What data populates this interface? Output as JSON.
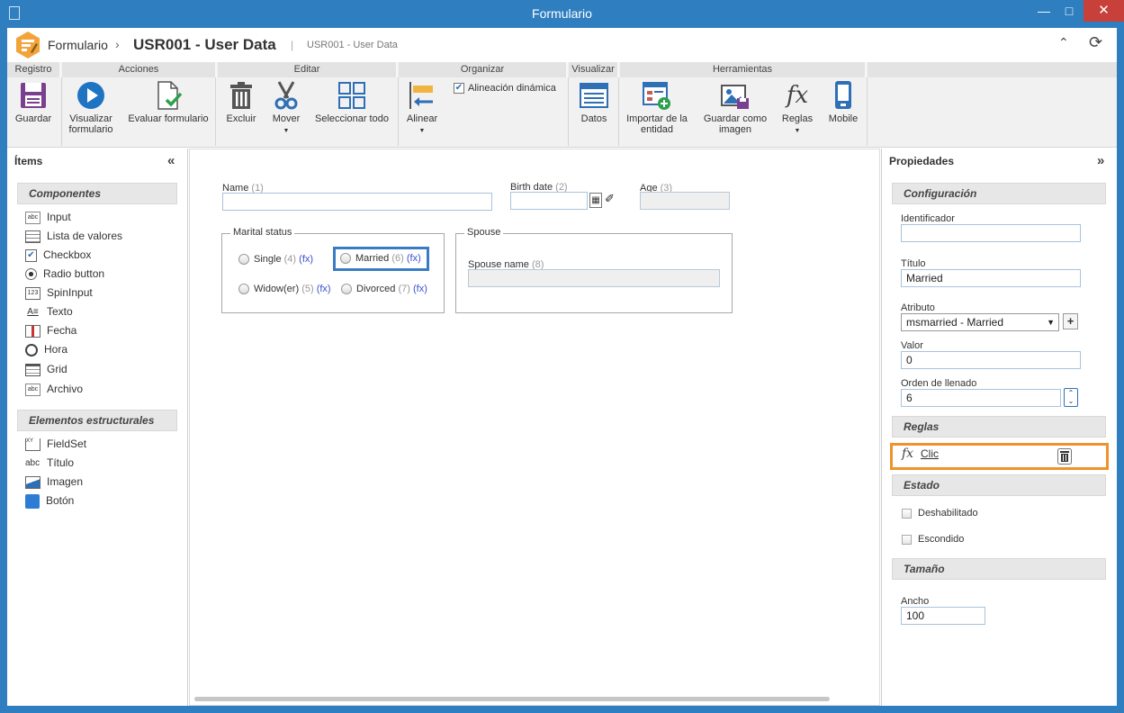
{
  "window": {
    "title": "Formulario",
    "minimize": "—",
    "maximize": "□",
    "close": "✕"
  },
  "header": {
    "app_name": "Formulario",
    "separator": "›",
    "doc_title": "USR001 - User Data",
    "pipe": "|",
    "doc_subtitle": "USR001 - User Data"
  },
  "ribbon": {
    "groups": [
      "Registro",
      "Acciones",
      "Editar",
      "Organizar",
      "Visualizar",
      "Herramientas"
    ],
    "buttons": {
      "guardar": "Guardar",
      "visualizar_1": "Visualizar",
      "visualizar_2": "formulario",
      "evaluar": "Evaluar formulario",
      "excluir": "Excluir",
      "mover": "Mover",
      "seleccionar": "Seleccionar todo",
      "alinear": "Alinear",
      "alineacion_dinamica": "Alineación dinámica",
      "datos": "Datos",
      "importar_1": "Importar de la",
      "importar_2": "entidad",
      "guardar_imagen_1": "Guardar como",
      "guardar_imagen_2": "imagen",
      "reglas": "Reglas",
      "mobile": "Mobile"
    },
    "alineacion_checked": true
  },
  "left_panel": {
    "title": "Ítems",
    "sections": {
      "componentes": "Componentes",
      "estructurales": "Elementos estructurales"
    },
    "components": [
      "Input",
      "Lista de valores",
      "Checkbox",
      "Radio button",
      "SpinInput",
      "Texto",
      "Fecha",
      "Hora",
      "Grid",
      "Archivo"
    ],
    "structural": [
      "FieldSet",
      "Título",
      "Imagen",
      "Botón"
    ]
  },
  "form": {
    "name_label": "Name",
    "name_num": "(1)",
    "birth_label": "Birth date",
    "birth_num": "(2)",
    "age_label": "Age",
    "age_num": "(3)",
    "marital_legend": "Marital status",
    "options": {
      "single": {
        "label": "Single",
        "num": "(4)",
        "fx": "(fx)"
      },
      "married": {
        "label": "Married",
        "num": "(6)",
        "fx": "(fx)"
      },
      "widow": {
        "label": "Widow(er)",
        "num": "(5)",
        "fx": "(fx)"
      },
      "divorced": {
        "label": "Divorced",
        "num": "(7)",
        "fx": "(fx)"
      }
    },
    "spouse_legend": "Spouse",
    "spouse_name_label": "Spouse name",
    "spouse_name_num": "(8)"
  },
  "right_panel": {
    "title": "Propiedades",
    "sections": {
      "configuracion": "Configuración",
      "reglas": "Reglas",
      "estado": "Estado",
      "tamano": "Tamaño"
    },
    "fields": {
      "identificador_label": "Identificador",
      "identificador_value": "",
      "titulo_label": "Título",
      "titulo_value": "Married",
      "atributo_label": "Atributo",
      "atributo_value": "msmarried - Married",
      "valor_label": "Valor",
      "valor_value": "0",
      "orden_label": "Orden de llenado",
      "orden_value": "6",
      "ancho_label": "Ancho",
      "ancho_value": "100"
    },
    "rule": {
      "fx": "fx",
      "label": "Clic"
    },
    "estado": {
      "deshabilitado": "Deshabilitado",
      "escondido": "Escondido"
    }
  },
  "colors": {
    "titlebar": "#2f7ec0",
    "close": "#c8403a",
    "selection_blue": "#3a7cc3",
    "highlight_orange": "#f0922b",
    "fx_link": "#3a4fd0"
  }
}
